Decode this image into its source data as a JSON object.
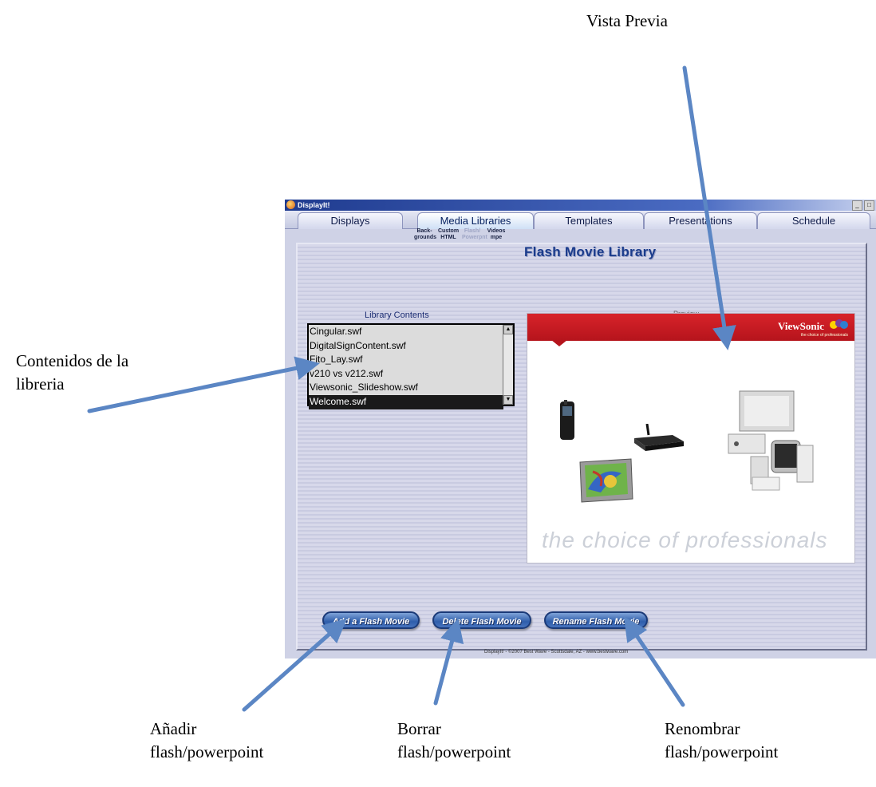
{
  "annotations": {
    "preview": "Vista Previa",
    "contents_line1": "Contenidos de la",
    "contents_line2": "libreria",
    "add_line1": "Añadir",
    "add_line2": "flash/powerpoint",
    "delete_line1": "Borrar",
    "delete_line2": "flash/powerpoint",
    "rename_line1": "Renombrar",
    "rename_line2": "flash/powerpoint"
  },
  "window": {
    "title": "DisplayIt!",
    "minimize": "_",
    "maximize": "□"
  },
  "tabs": [
    "Displays",
    "Media Libraries",
    "Templates",
    "Presentations",
    "Schedule"
  ],
  "active_tab": "Media Libraries",
  "subtabs": [
    {
      "line1": "Back-",
      "line2": "grounds"
    },
    {
      "line1": "Custom",
      "line2": "HTML"
    },
    {
      "line1": "Flash/",
      "line2": "Powerpnt"
    },
    {
      "line1": "Videos",
      "line2": "mpe"
    }
  ],
  "panel": {
    "title": "Flash Movie Library",
    "library_label": "Library Contents",
    "preview_label": "Preview"
  },
  "library_items": [
    "Cingular.swf",
    "DigitalSignContent.swf",
    "Fito_Lay.swf",
    "v210 vs v212.swf",
    "Viewsonic_Slideshow.swf",
    "Welcome.swf"
  ],
  "selected_item": "Welcome.swf",
  "preview_content": {
    "brand": "ViewSonic",
    "tagline": "the choice of professionals",
    "slogan": "the choice of professionals"
  },
  "buttons": {
    "add": "Add a Flash Movie",
    "delete": "Delete Flash Movie",
    "rename": "Rename Flash Movie"
  },
  "footer": "DisplayIt! - ©2007 Best Wave - Scottsdale, AZ - www.bestwave.com",
  "colors": {
    "arrow": "#5b86c4",
    "accent": "#1b3c8c",
    "brand_red": "#c8192a"
  }
}
